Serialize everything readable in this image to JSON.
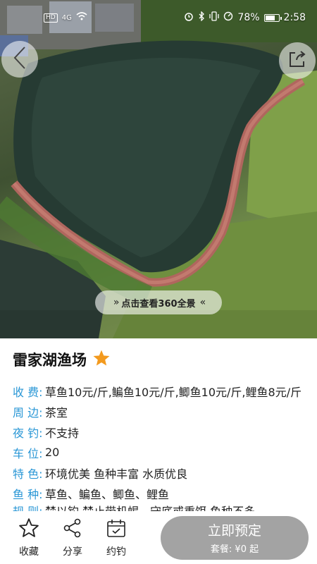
{
  "status_bar": {
    "left_badge": "HD",
    "network": "4G",
    "battery_percent": "78%",
    "battery_level": 0.78,
    "time": "2:58"
  },
  "hero": {
    "pano_label": "点击查看360全景",
    "pano_left_glyph": "»",
    "pano_right_glyph": "«"
  },
  "venue": {
    "name": "雷家湖渔场",
    "star_color": "#f39a1e",
    "details": [
      {
        "label": "收 费:",
        "value": "草鱼10元/斤,鳊鱼10元/斤,鲫鱼10元/斤,鲤鱼8元/斤"
      },
      {
        "label": "周 边:",
        "value": "茶室"
      },
      {
        "label": "夜 钓:",
        "value": "不支持"
      },
      {
        "label": "车 位:",
        "value": "20"
      },
      {
        "label": "特 色:",
        "value": "环境优美 鱼种丰富 水质优良"
      },
      {
        "label": "鱼 种:",
        "value": "草鱼、鳊鱼、鲫鱼、鲤鱼"
      },
      {
        "label": "规 则:",
        "value": "禁以钓 禁止带机蝎，守底或重饵 鱼种不多"
      }
    ]
  },
  "bottom_bar": {
    "favorite_label": "收藏",
    "share_label": "分享",
    "appointment_label": "约钓",
    "book_label": "立即预定",
    "package_label": "套餐: ¥0 起",
    "book_button_color": "#a3a3a3"
  },
  "colors": {
    "label_blue": "#2a97d6"
  }
}
